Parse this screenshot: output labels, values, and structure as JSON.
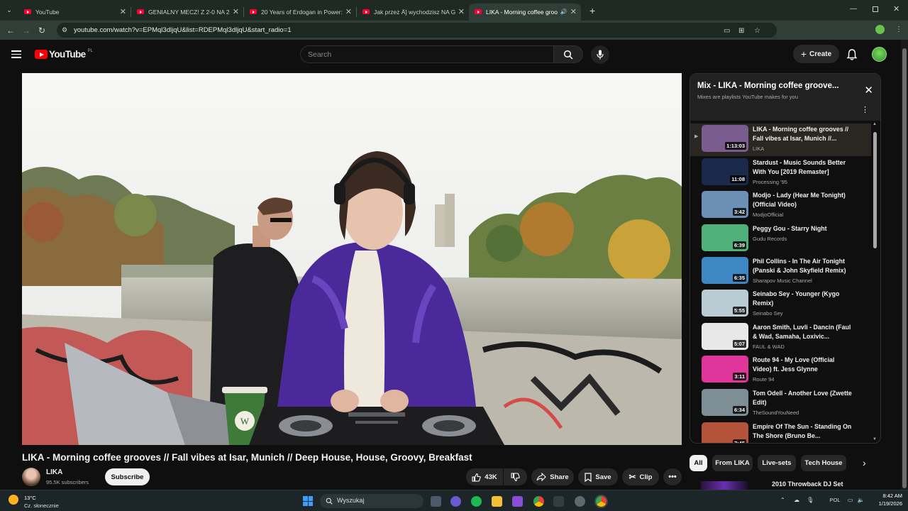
{
  "browser": {
    "tabs": [
      {
        "title": "YouTube",
        "active": false
      },
      {
        "title": "GENIALNY MECZ! Z 2-0 NA 2-4!",
        "active": false
      },
      {
        "title": "20 Years of Erdogan in Power: T",
        "active": false
      },
      {
        "title": "Jak przez Ä] wychodzisz NA GL",
        "active": false
      },
      {
        "title": "LIKA - Morning coffee groo",
        "active": true
      }
    ],
    "new_tab": "+",
    "url": "youtube.com/watch?v=EPMql3dljqU&list=RDEPMql3dljqU&start_radio=1"
  },
  "header": {
    "logo_text": "YouTube",
    "country_code": "PL",
    "search_placeholder": "Search",
    "create_label": "Create"
  },
  "video": {
    "title": "LIKA - Morning coffee grooves // Fall vibes at Isar, Munich // Deep House, House, Groovy, Breakfast",
    "channel": "LIKA",
    "subscribers": "95.5K subscribers",
    "subscribe_label": "Subscribe",
    "likes": "43K",
    "share_label": "Share",
    "save_label": "Save",
    "clip_label": "Clip",
    "cup_logo": "W"
  },
  "playlist": {
    "title": "Mix - LIKA - Morning coffee groove...",
    "subtitle": "Mixes are playlists YouTube makes for you",
    "current_marker": "▶",
    "items": [
      {
        "title": "LIKA - Morning coffee grooves // Fall vibes at Isar, Munich //...",
        "channel": "LIKA",
        "duration": "1:13:03",
        "current": true,
        "thumb_color": "#7a5c8e"
      },
      {
        "title": "Stardust - Music Sounds Better With You [2019 Remaster]",
        "channel": "Processing '95",
        "duration": "11:08",
        "current": false,
        "thumb_color": "#1b2a4a"
      },
      {
        "title": "Modjo - Lady (Hear Me Tonight) (Official Video)",
        "channel": "ModjoOfficial",
        "duration": "3:42",
        "current": false,
        "thumb_color": "#6b8fb5"
      },
      {
        "title": "Peggy Gou - Starry Night",
        "channel": "Gudu Records",
        "duration": "6:39",
        "current": false,
        "thumb_color": "#4fb07a"
      },
      {
        "title": "Phil Collins - In The Air Tonight (Panski & John Skyfield Remix)",
        "channel": "Sharapov Music Channel",
        "duration": "6:35",
        "current": false,
        "thumb_color": "#3d88c4"
      },
      {
        "title": "Seinabo Sey - Younger (Kygo Remix)",
        "channel": "Seinabo Sey",
        "duration": "5:55",
        "current": false,
        "thumb_color": "#b9ccd4"
      },
      {
        "title": "Aaron Smith, Luvli - Dancin (Faul & Wad, Samaha, Loxivic...",
        "channel": "FAUL & WAD",
        "duration": "5:07",
        "current": false,
        "thumb_color": "#e8e8e8"
      },
      {
        "title": "Route 94 - My Love (Official Video) ft. Jess Glynne",
        "channel": "Route 94",
        "duration": "3:11",
        "current": false,
        "thumb_color": "#e0359a"
      },
      {
        "title": "Tom Odell - Another Love (Zwette Edit)",
        "channel": "TheSoundYouNeed",
        "duration": "6:34",
        "current": false,
        "thumb_color": "#7d8f95"
      },
      {
        "title": "Empire Of The Sun - Standing On The Shore (Bruno Be...",
        "channel": "...",
        "duration": "7:45",
        "current": false,
        "thumb_color": "#b5533a"
      }
    ]
  },
  "chips": {
    "items": [
      "All",
      "From LIKA",
      "Live-sets",
      "Tech House"
    ],
    "next_label": "2010 Throwback DJ Set"
  },
  "taskbar": {
    "temperature": "13°C",
    "weather": "Cz. słonecznie",
    "search_placeholder": "Wyszukaj",
    "lang": "POL",
    "time": "8:42 AM",
    "date": "1/19/2026"
  }
}
